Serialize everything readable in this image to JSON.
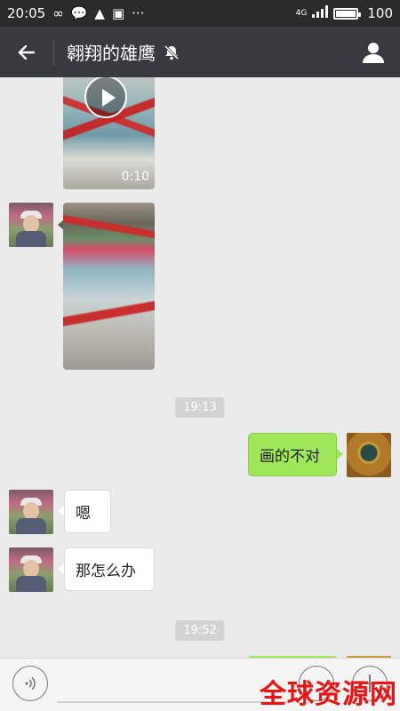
{
  "status_bar": {
    "time": "20:05",
    "network": "4G",
    "battery": "100",
    "battery_level": 1.0
  },
  "header": {
    "title": "翱翔的雄鹰",
    "back_icon": "back-arrow-icon",
    "mute_icon": "bell-muted-icon",
    "profile_icon": "person-icon"
  },
  "messages": {
    "video_duration": "0:10",
    "timestamp_1": "19:13",
    "sent_1": "画的不对",
    "recv_1": "嗯",
    "recv_2": "那怎么办",
    "timestamp_2": "19:52"
  },
  "input_bar": {
    "voice_icon": "voice-icon",
    "emoji_icon": "emoji-icon",
    "plus_icon": "plus-icon"
  },
  "watermark": "全球资源网",
  "colors": {
    "header_bg": "#393a3f",
    "sent_bubble": "#9fe658",
    "chat_bg": "#ebebeb"
  }
}
